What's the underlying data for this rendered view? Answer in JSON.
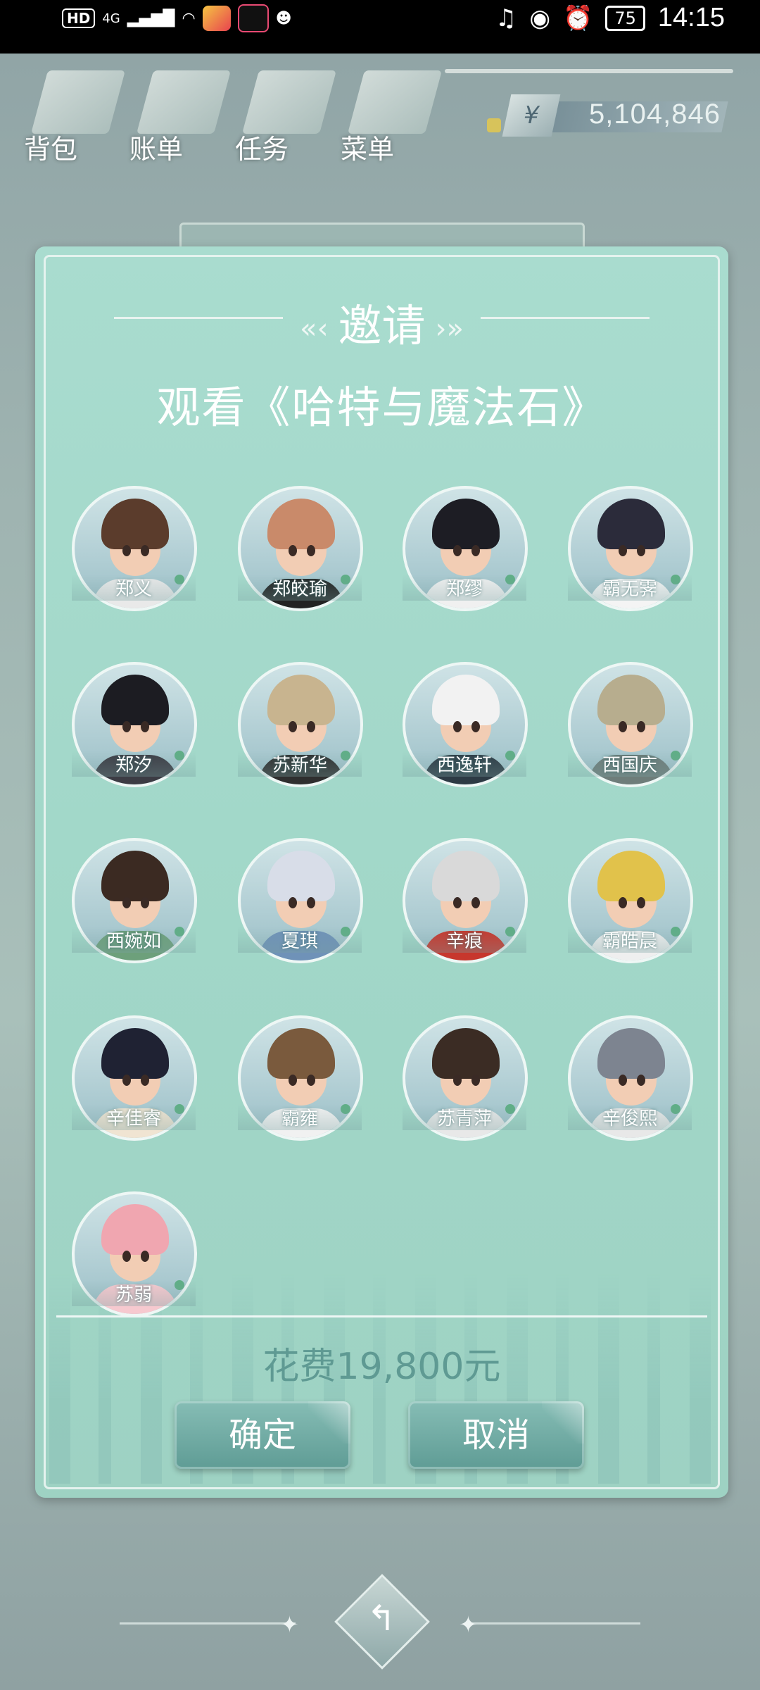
{
  "status_bar": {
    "hd": "HD",
    "network": "4G",
    "battery": "75",
    "time": "14:15",
    "icons": [
      "signal-icon",
      "wifi-icon",
      "app-icon",
      "tiktok-icon",
      "qq-icon",
      "headphones-icon",
      "eye-icon",
      "alarm-icon",
      "battery-icon"
    ]
  },
  "topbar": {
    "buttons": [
      {
        "label": "背包",
        "icon": "backpack-icon"
      },
      {
        "label": "账单",
        "icon": "bill-icon"
      },
      {
        "label": "任务",
        "icon": "task-icon"
      },
      {
        "label": "菜单",
        "icon": "menu-icon"
      }
    ],
    "currency_symbol": "¥",
    "money": "5,104,846"
  },
  "dialog": {
    "title": "邀请",
    "subtitle": "观看《哈特与魔法石》",
    "friends": [
      {
        "name": "郑义",
        "hair": "#5b3c2c",
        "body": "#e9e9e9"
      },
      {
        "name": "郑皎瑜",
        "hair": "#c98a6a",
        "body": "#222222"
      },
      {
        "name": "郑缪",
        "hair": "#1d1d24",
        "body": "#f0f0f0"
      },
      {
        "name": "霸无霁",
        "hair": "#2b2b3a",
        "body": "#f4f4f4"
      },
      {
        "name": "郑汐",
        "hair": "#1c1c22",
        "body": "#3c3c44"
      },
      {
        "name": "苏新华",
        "hair": "#c8b48f",
        "body": "#2f2f2f"
      },
      {
        "name": "西逸轩",
        "hair": "#f2f2f2",
        "body": "#2d3a44"
      },
      {
        "name": "西国庆",
        "hair": "#b7ad8e",
        "body": "#6e7d7a"
      },
      {
        "name": "西婉如",
        "hair": "#3b2a22",
        "body": "#6da07b"
      },
      {
        "name": "夏琪",
        "hair": "#d8dde8",
        "body": "#6f92b8"
      },
      {
        "name": "辛痕",
        "hair": "#d9d9d9",
        "body": "#c7372d"
      },
      {
        "name": "霸皓晨",
        "hair": "#e1c24b",
        "body": "#efefef"
      },
      {
        "name": "辛佳睿",
        "hair": "#1f2233",
        "body": "#f0e4d2"
      },
      {
        "name": "霸雍",
        "hair": "#7a5a3d",
        "body": "#f1f1f1"
      },
      {
        "name": "苏青萍",
        "hair": "#3b2c24",
        "body": "#e8e8e8"
      },
      {
        "name": "辛俊熙",
        "hair": "#7d8490",
        "body": "#e8e8e8"
      },
      {
        "name": "苏弱",
        "hair": "#f0a6b0",
        "body": "#f6c9cf"
      }
    ],
    "cost": "花费19,800元",
    "confirm": "确定",
    "cancel": "取消"
  },
  "back_icon": "back-arrow-icon"
}
